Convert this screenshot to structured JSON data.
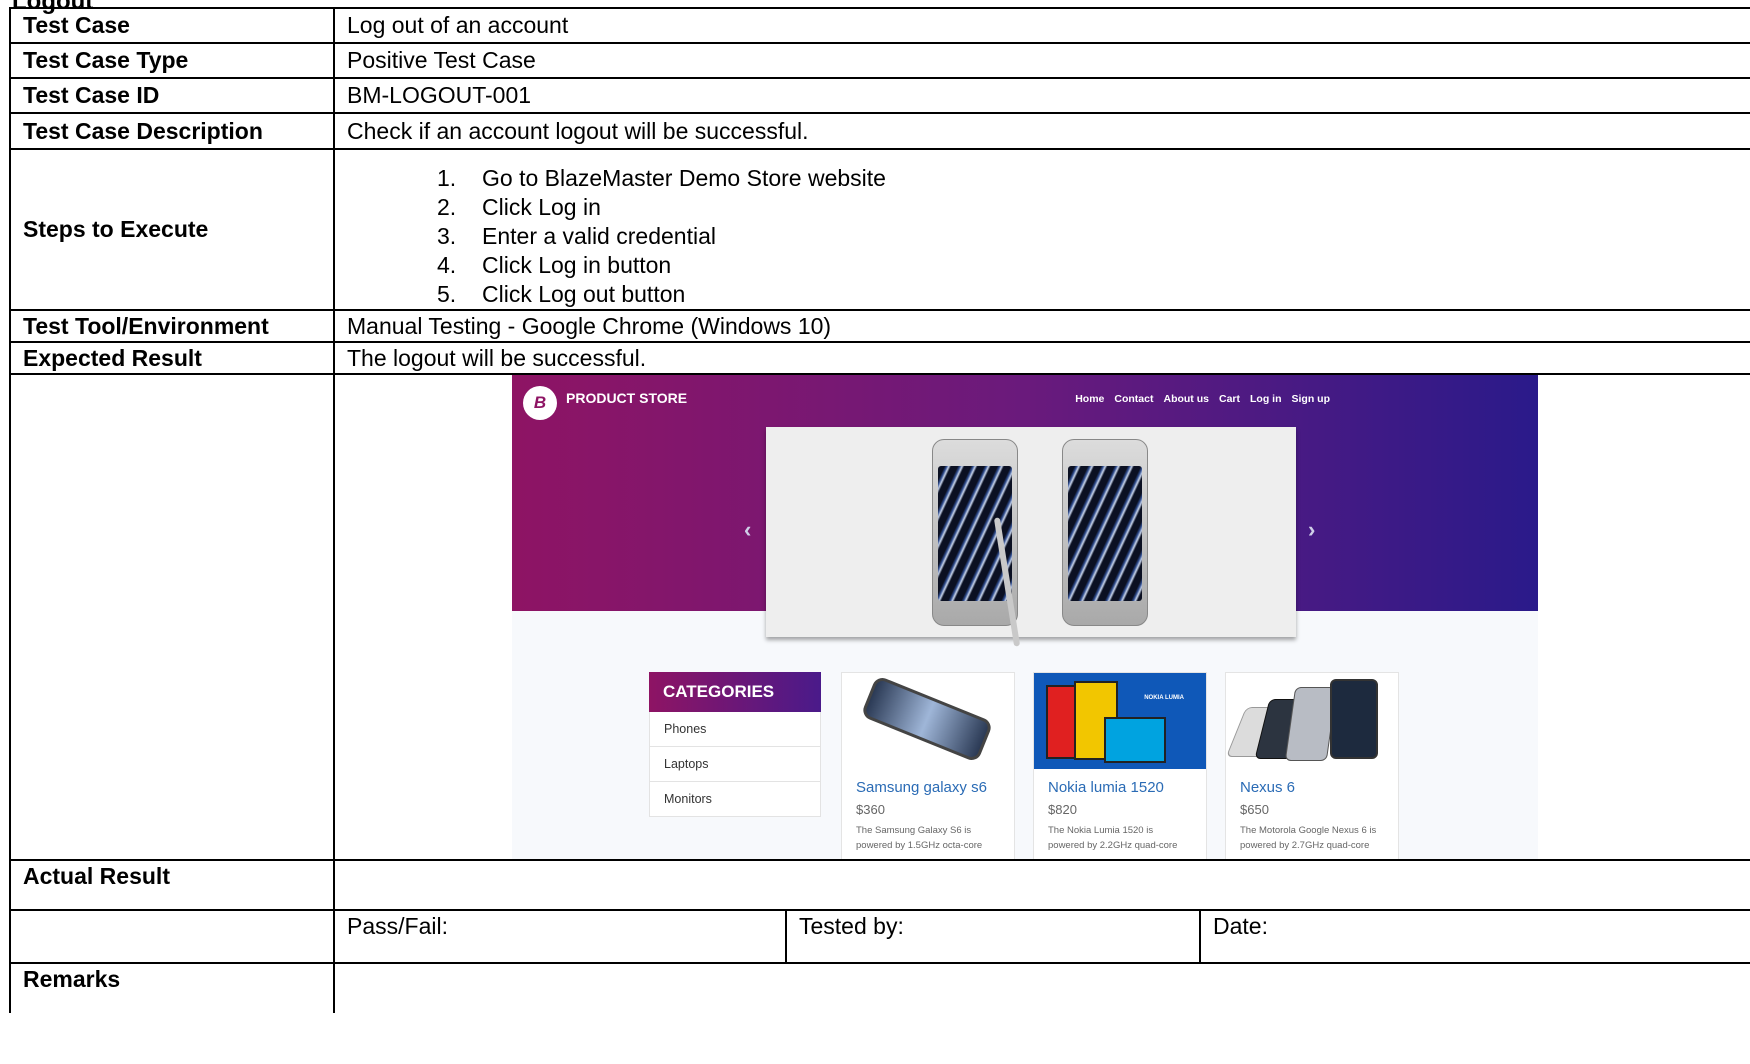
{
  "page_heading_fragment": "Logout",
  "rows": {
    "test_case": {
      "label": "Test Case",
      "value": "Log out of an account"
    },
    "test_case_type": {
      "label": "Test Case Type",
      "value": "Positive Test Case"
    },
    "test_case_id": {
      "label": "Test Case ID",
      "value": "BM-LOGOUT-001"
    },
    "description": {
      "label": "Test Case Description",
      "value": "Check if an account logout will be successful."
    },
    "steps": {
      "label": "Steps to Execute",
      "items": [
        {
          "num": "1.",
          "text": "Go to BlazeMaster Demo Store website"
        },
        {
          "num": "2.",
          "text": "Click Log in"
        },
        {
          "num": "3.",
          "text": "Enter a valid credential"
        },
        {
          "num": "4.",
          "text": "Click Log in button"
        },
        {
          "num": "5.",
          "text": "Click Log out button"
        }
      ]
    },
    "tool": {
      "label": "Test Tool/Environment",
      "value": "Manual Testing - Google Chrome (Windows 10)"
    },
    "expected": {
      "label": "Expected Result",
      "value": "The logout will be successful."
    },
    "actual": {
      "label": "Actual Result",
      "value": ""
    },
    "pass_fail": {
      "label": "Pass/Fail:"
    },
    "tested_by": {
      "label": "Tested by:"
    },
    "date": {
      "label": "Date:"
    },
    "remarks": {
      "label": "Remarks",
      "value": ""
    }
  },
  "screenshot": {
    "logo_letter": "B",
    "brand": "PRODUCT STORE",
    "nav": [
      "Home",
      "Contact",
      "About us",
      "Cart",
      "Log in",
      "Sign up"
    ],
    "arrow_left": "‹",
    "arrow_right": "›",
    "categories": {
      "title": "CATEGORIES",
      "items": [
        "Phones",
        "Laptops",
        "Monitors"
      ]
    },
    "products": [
      {
        "title": "Samsung galaxy s6",
        "price": "$360",
        "desc": "The Samsung Galaxy S6 is powered by 1.5GHz octa-core"
      },
      {
        "title": "Nokia lumia 1520",
        "price": "$820",
        "desc": "The Nokia Lumia 1520 is powered by 2.2GHz quad-core",
        "badge": "NOKIA LUMIA"
      },
      {
        "title": "Nexus 6",
        "price": "$650",
        "desc": "The Motorola Google Nexus 6 is powered by 2.7GHz quad-core"
      }
    ],
    "colors": {
      "hero_left": "#8e1464",
      "hero_right": "#2a1a8a",
      "link": "#2a6bb5"
    }
  }
}
